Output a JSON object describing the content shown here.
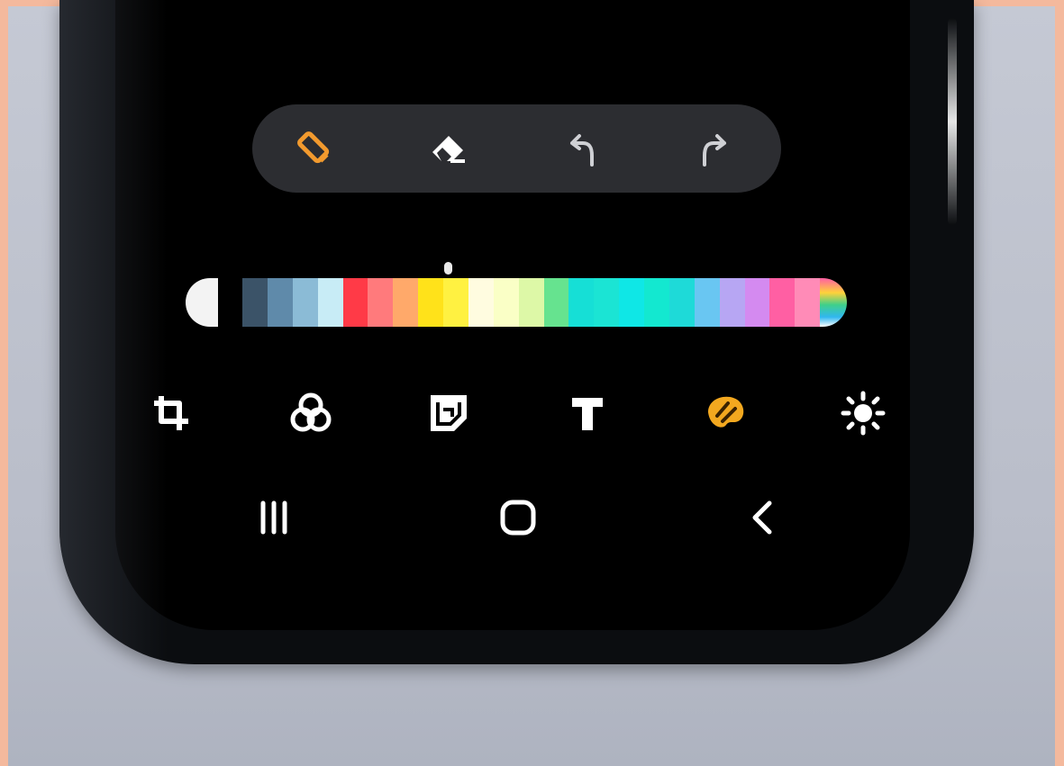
{
  "toolbar": {
    "tools": [
      {
        "icon": "pen-icon",
        "active": true,
        "color": "#f29a2e"
      },
      {
        "icon": "eraser-icon",
        "active": false
      },
      {
        "icon": "undo-icon",
        "active": false
      },
      {
        "icon": "redo-icon",
        "active": false
      }
    ]
  },
  "palette": {
    "selected_indicator": "palette-selection-indicator",
    "fixed_first": "#f3f3f3",
    "colors": [
      "#3b5368",
      "#5f8aaa",
      "#8bbbd6",
      "#c8ecf6",
      "#ff3a47",
      "#ff7a7c",
      "#ffa96a",
      "#ffe21a",
      "#fff141",
      "#fffce0",
      "#faffc6",
      "#ddf8a7",
      "#66e38f",
      "#16dfd6",
      "#1be4d4",
      "#0fe7e6",
      "#13e8d0",
      "#1edad8",
      "#69c6f2",
      "#b7a6f3",
      "#d48af0",
      "#ff5fa3",
      "#ff8bb7"
    ],
    "last_swatch": "multicolor-picker-icon"
  },
  "editor_tools": [
    {
      "icon": "crop-rotate-icon",
      "active": false
    },
    {
      "icon": "filters-icon",
      "active": false
    },
    {
      "icon": "sticker-icon",
      "active": false
    },
    {
      "icon": "text-icon",
      "active": false
    },
    {
      "icon": "draw-palette-icon",
      "active": true,
      "color": "#f3a81f"
    },
    {
      "icon": "brightness-icon",
      "active": false
    }
  ],
  "navigation": [
    {
      "icon": "recent-apps-icon"
    },
    {
      "icon": "home-icon"
    },
    {
      "icon": "back-icon"
    }
  ],
  "colors": {
    "accent": "#f29a2e",
    "toolbar_bg": "#2c2d31",
    "icon_default": "#ffffff",
    "icon_muted": "#cfd0d4"
  }
}
